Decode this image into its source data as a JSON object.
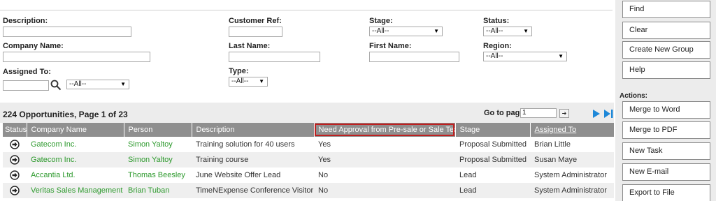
{
  "search": {
    "description": {
      "label": "Description:",
      "value": ""
    },
    "customer_ref": {
      "label": "Customer Ref:",
      "value": ""
    },
    "stage": {
      "label": "Stage:",
      "selected": "--All--"
    },
    "status": {
      "label": "Status:",
      "selected": "--All--"
    },
    "company_name": {
      "label": "Company Name:",
      "value": ""
    },
    "last_name": {
      "label": "Last Name:",
      "value": ""
    },
    "first_name": {
      "label": "First Name:",
      "value": ""
    },
    "region": {
      "label": "Region:",
      "selected": "--All--"
    },
    "assigned_to": {
      "label": "Assigned To:",
      "value": "",
      "selected": "--All--"
    },
    "type": {
      "label": "Type:",
      "selected": "--All--"
    }
  },
  "results": {
    "summary": "224 Opportunities, Page 1 of 23",
    "goto_label": "Go to page",
    "goto_value": "1"
  },
  "table": {
    "columns": [
      "Status",
      "Company Name",
      "Person",
      "Description",
      "Need Approval from Pre-sale or Sale Team",
      "Stage",
      "Assigned To"
    ],
    "rows": [
      {
        "company": "Gatecom Inc.",
        "person": "Simon Yaltoy",
        "description": "Training solution for 40 users",
        "approval": "Yes",
        "stage": "Proposal Submitted",
        "assigned": "Brian Little"
      },
      {
        "company": "Gatecom Inc.",
        "person": "Simon Yaltoy",
        "description": "Training course",
        "approval": "Yes",
        "stage": "Proposal Submitted",
        "assigned": "Susan Maye"
      },
      {
        "company": "Accantia Ltd.",
        "person": "Thomas Beesley",
        "description": "June Website Offer Lead",
        "approval": "No",
        "stage": "Lead",
        "assigned": "System Administrator"
      },
      {
        "company": "Veritas Sales Management",
        "person": "Brian Tuban",
        "description": "TimeNExpense Conference Visitor",
        "approval": "No",
        "stage": "Lead",
        "assigned": "System Administrator"
      }
    ]
  },
  "sidebar": {
    "find": "Find",
    "clear": "Clear",
    "create_group": "Create New Group",
    "help": "Help",
    "actions_label": "Actions:",
    "merge_word": "Merge to Word",
    "merge_pdf": "Merge to PDF",
    "new_task": "New Task",
    "new_email": "New E-mail",
    "export": "Export to File"
  },
  "colors": {
    "link_green": "#2e9a2e",
    "header_gray": "#8f8f8f",
    "nav_blue": "#1e88d8",
    "highlight_red": "#c02020"
  }
}
